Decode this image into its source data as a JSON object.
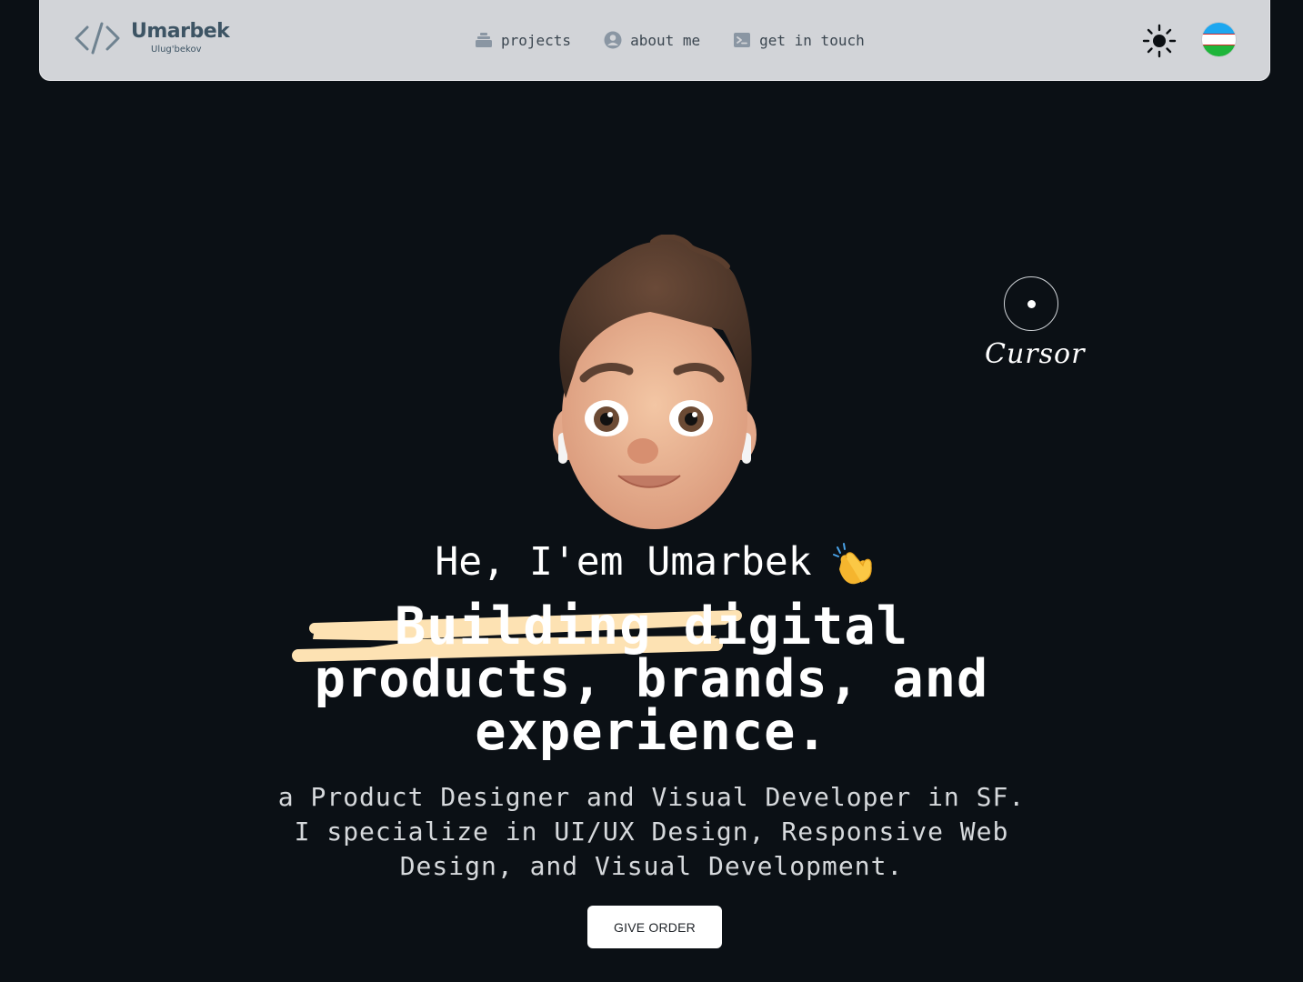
{
  "nav": {
    "logo_name": "Umarbek",
    "logo_sub": "Ulug'bekov",
    "links": [
      {
        "label": "projects",
        "icon": "stack-icon"
      },
      {
        "label": "about me",
        "icon": "user-circle-icon"
      },
      {
        "label": "get in touch",
        "icon": "terminal-icon"
      }
    ],
    "theme_icon": "sun-icon",
    "language_flag": "uzbekistan-flag"
  },
  "cursor_widget": {
    "label": "Cursor"
  },
  "hero": {
    "greeting": "He, I'em Umarbek",
    "greeting_icon": "clapping-hands-icon",
    "headline_lines": [
      "Building digital",
      "products, brands, and",
      "experience."
    ],
    "subtext_lines": [
      "a Product Designer and Visual Developer in SF.",
      "I specialize in UI/UX Design, Responsive Web",
      "Design, and Visual Development."
    ],
    "cta_label": "GIVE ORDER"
  },
  "colors": {
    "background": "#0b1015",
    "navbar": "#d2d4d8",
    "nav_text": "#3b4650",
    "logo": "#3d5464",
    "scribble": "#fde2b3",
    "cta_bg": "#ffffff"
  }
}
